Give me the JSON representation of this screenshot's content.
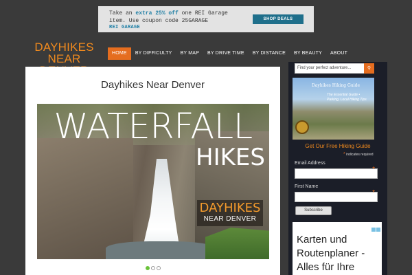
{
  "top_ad": {
    "line1_pre": "Take an ",
    "line1_highlight": "extra 25% off",
    "line1_post": " one REI Garage",
    "line2": "item. Use coupon code 25GARAGE",
    "brand": "REI GARAGE",
    "button": "SHOP DEALS"
  },
  "logo": {
    "line1": "DAYHIKES",
    "line2": "NEAR DENVER"
  },
  "nav": {
    "items": [
      "HOME",
      "BY DIFFICULTY",
      "BY MAP",
      "BY DRIVE TIME",
      "BY DISTANCE",
      "BY BEAUTY",
      "ABOUT"
    ],
    "active": "HOME",
    "accent_color": "#e56d1f"
  },
  "main": {
    "title": "Dayhikes Near Denver",
    "hero": {
      "headline1": "WATERFALL",
      "headline2": "HIKES",
      "badge_line1": "DAYHIKES",
      "badge_line2": "NEAR DENVER"
    },
    "slider_dots": 3,
    "active_dot": 0
  },
  "sidebar": {
    "search_placeholder": "Find your perfect adventure...",
    "guide": {
      "book_title": "Dayhikes Hiking Guide",
      "book_sub": "The Essential Guide • Parking, Local Hiking Tips"
    },
    "cta": "Get Our Free Hiking Guide",
    "required_note": "indicates required",
    "email_label": "Email Address",
    "first_name_label": "First Name",
    "subscribe_label": "Subscribe",
    "ad_text": "Karten und Routenplaner - Alles für Ihre"
  }
}
